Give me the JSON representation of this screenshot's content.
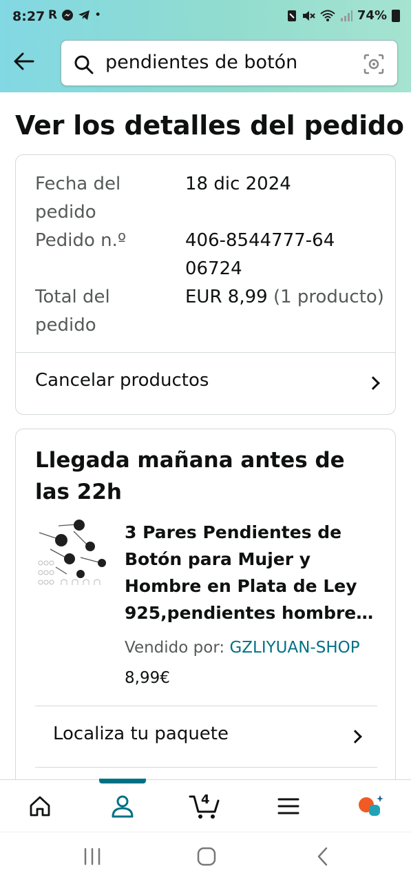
{
  "status_bar": {
    "time": "8:27",
    "left_icons": [
      "R",
      "messenger-icon",
      "telegram-icon",
      "•"
    ],
    "battery": "74%"
  },
  "search": {
    "query": "pendientes de botón"
  },
  "page": {
    "title": "Ver los detalles del pedido"
  },
  "order_summary": {
    "date_label": "Fecha del pedido",
    "date_value": "18 dic 2024",
    "number_label": "Pedido n.º",
    "number_value": "406-8544777-6406724",
    "total_label": "Total del pedido",
    "total_value": "EUR 8,99",
    "total_qty": "(1 producto)",
    "cancel_label": "Cancelar productos"
  },
  "shipment": {
    "arrival": "Llegada mañana antes de las 22h",
    "product_title": "3 Pares Pendientes de Botón para Mujer y Hombre en Plata de Ley 925,pendientes hombre de bolas negras",
    "sold_by_label": "Vendido por:",
    "seller": "GZLIYUAN-SHOP",
    "price": "8,99€",
    "track_label": "Localiza tu paquete"
  },
  "bottom_nav": {
    "items": [
      "home-icon",
      "account-icon",
      "cart-icon",
      "menu-icon",
      "assistant-icon"
    ],
    "cart_count": "4",
    "active": "account-icon",
    "accent": "#007185"
  },
  "colors": {
    "header_gradient_start": "#82d8e3",
    "header_gradient_end": "#a6e3d0",
    "link": "#007185",
    "muted_text": "#565959"
  }
}
